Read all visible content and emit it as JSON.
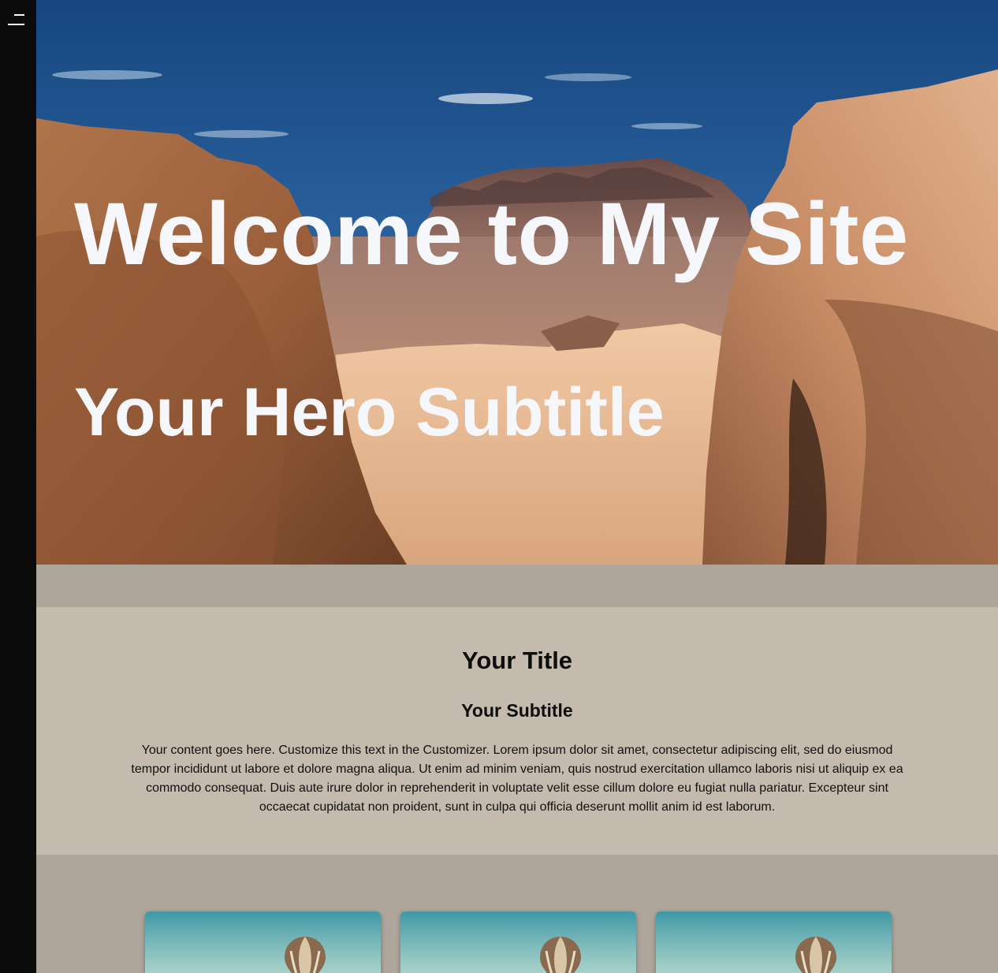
{
  "sidebar": {
    "menu_icon": "hamburger-menu-icon",
    "background": "#0b0b0b"
  },
  "hero": {
    "title": "Welcome to My Site",
    "subtitle": "Your Hero Subtitle",
    "image_subject": "desert-rock-canyon",
    "text_color": "#f6f7fa"
  },
  "content": {
    "title": "Your Title",
    "subtitle": "Your Subtitle",
    "body": "Your content goes here. Customize this text in the Customizer. Lorem ipsum dolor sit amet, consectetur adipiscing elit, sed do eiusmod tempor incididunt ut labore et dolore magna aliqua. Ut enim ad minim veniam, quis nostrud exercitation ullamco laboris nisi ut aliquip ex ea commodo consequat. Duis aute irure dolor in reprehenderit in voluptate velit esse cillum dolore eu fugiat nulla pariatur. Excepteur sint occaecat cupidatat non proident, sunt in culpa qui officia deserunt mollit anim id est laborum.",
    "background": "#c4baad"
  },
  "cards": [
    {
      "image_subject": "hot-air-balloon"
    },
    {
      "image_subject": "hot-air-balloon"
    },
    {
      "image_subject": "hot-air-balloon"
    }
  ],
  "colors": {
    "page_background": "#aea69b",
    "text_dark": "#0d0d0d"
  }
}
